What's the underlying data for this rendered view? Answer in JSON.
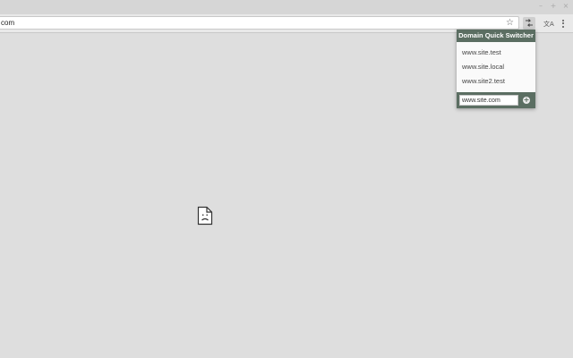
{
  "window": {
    "controls": [
      "–",
      "+",
      "×"
    ]
  },
  "toolbar": {
    "omnibox_text": "com",
    "star_icon": "star-icon",
    "extension_icon": "domain-switcher-icon",
    "other_extension_icon": "translate-icon",
    "menu_icon": "kebab-menu-icon"
  },
  "popup": {
    "title": "Domain Quick Switcher",
    "domains": [
      "www.site.test",
      "www.site.local",
      "www.site2.test"
    ],
    "input_value": "www.site.com",
    "add_button_label": "+",
    "colors": {
      "header": "#5b6e62",
      "background": "#fafafa"
    }
  },
  "content": {
    "error_icon": "sad-page-icon"
  }
}
